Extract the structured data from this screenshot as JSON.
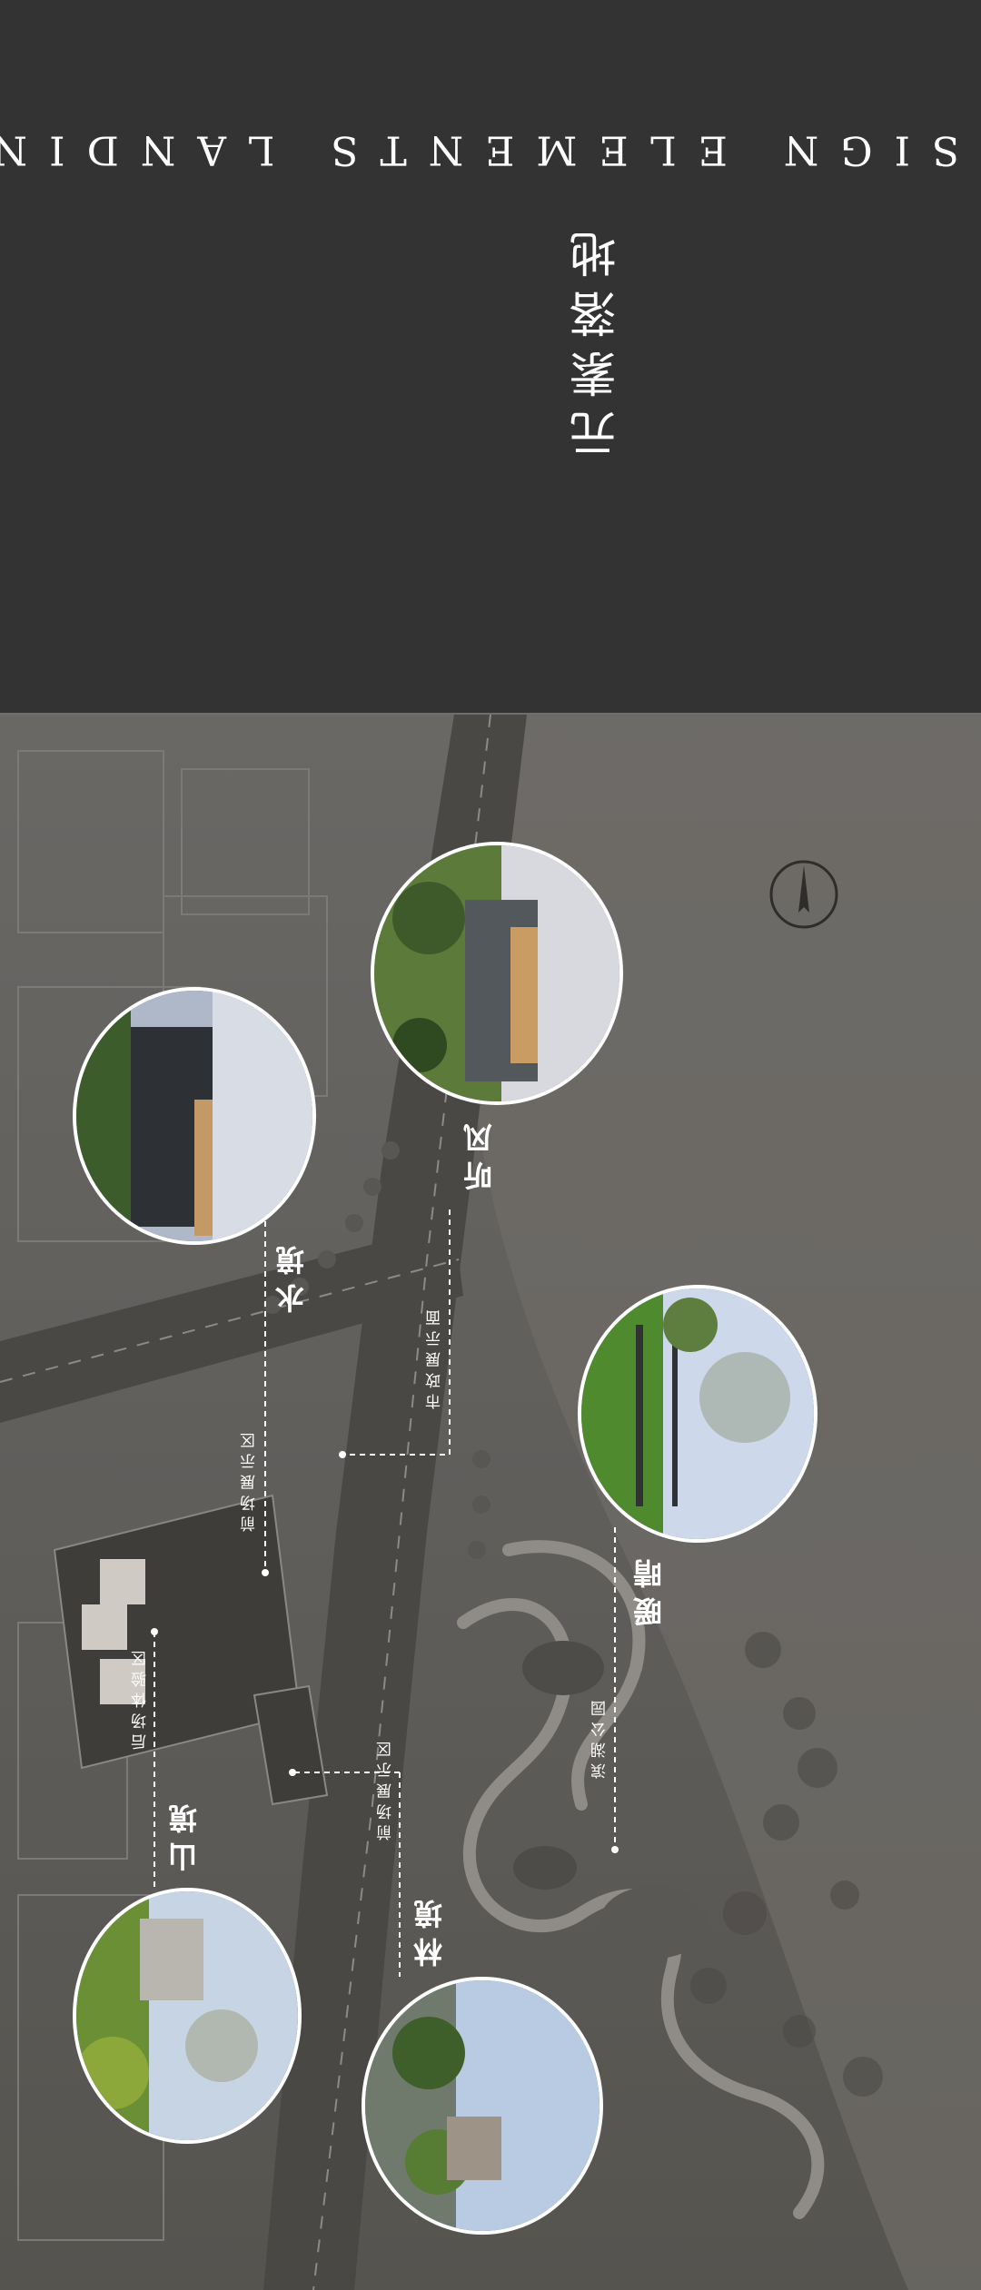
{
  "header": {
    "english_title": "DESIGN  ELEMENTS  LANDING",
    "chinese_title": "元素落地"
  },
  "zones": [
    {
      "title": "听风",
      "subtitle": "市政展示面",
      "photo_icon": "building-photo"
    },
    {
      "title": "水境",
      "subtitle": "前场展示区",
      "photo_icon": "building-photo"
    },
    {
      "title": "暖晴",
      "subtitle": "滨湖公园",
      "photo_icon": "lawn-photo"
    },
    {
      "title": "山境",
      "subtitle": "后场体验区",
      "photo_icon": "garden-photo"
    },
    {
      "title": "林境",
      "subtitle": "前场展示区",
      "photo_icon": "garden-photo"
    }
  ],
  "compass_icon": "north-arrow-icon",
  "colors": {
    "header_bg": "#333333",
    "plan_bg": "#63615e",
    "accent": "#ffffff"
  }
}
